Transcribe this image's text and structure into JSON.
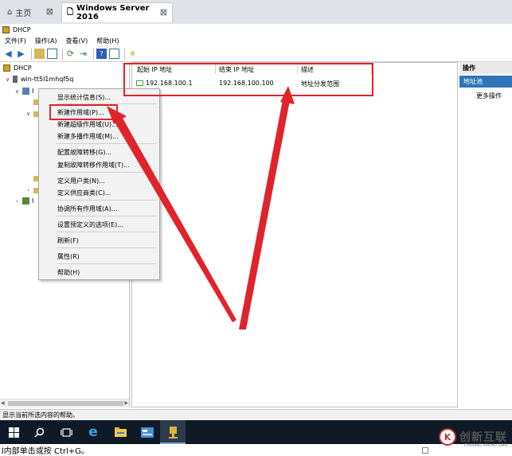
{
  "browser": {
    "tabs": [
      {
        "label": "主页",
        "icon": "home-icon"
      },
      {
        "label": "Windows Server 2016",
        "icon": "document-icon"
      }
    ],
    "close_glyph": "⊠"
  },
  "window": {
    "title": "DHCP"
  },
  "menubar": [
    "文件(F)",
    "操作(A)",
    "查看(V)",
    "帮助(H)"
  ],
  "toolbar": {
    "icons": [
      "back-arrow-icon",
      "forward-arrow-icon",
      "up-folder-icon",
      "console-tree-icon",
      "refresh-icon",
      "export-icon",
      "help-icon",
      "properties-icon",
      "star-icon"
    ]
  },
  "tree": {
    "root": "DHCP",
    "server": "win-tt5l1mhqf5q",
    "ipv4_partial": "I",
    "ipv6_partial": "I"
  },
  "table": {
    "columns": [
      "起始 IP 地址",
      "结束 IP 地址",
      "描述"
    ],
    "rows": [
      {
        "start": "192.168.100.1",
        "end": "192.168.100.100",
        "desc": "地址分发范围"
      }
    ]
  },
  "actions": {
    "title": "操作",
    "section": "地址池",
    "more": "更多操作"
  },
  "context_menu": {
    "items": [
      "显示统计信息(S)...",
      "新建作用域(P)...",
      "新建超级作用域(U)...",
      "新建多播作用域(M)...",
      "配置故障转移(G)...",
      "复制故障转移作用域(T)...",
      "定义用户类(N)...",
      "定义供应商类(C)...",
      "协调所有作用域(A)...",
      "设置预定义的选项(E)...",
      "刷新(F)",
      "属性(R)",
      "帮助(H)"
    ]
  },
  "statusbar": {
    "text": "显示当前所选内容的帮助。"
  },
  "taskbar": {
    "icons": [
      "windows-start-icon",
      "search-icon",
      "task-view-icon",
      "internet-explorer-icon",
      "file-explorer-icon",
      "server-manager-icon",
      "dhcp-console-icon"
    ]
  },
  "bottom_strip": {
    "text": "l内部单击或按 Ctrl+G。"
  },
  "watermark": {
    "text": "创新互联",
    "sub": "CHUANG XIN HU LIAN",
    "badge": "K"
  },
  "colors": {
    "annotation_red": "#e0242b",
    "selection_blue": "#2f76b8",
    "taskbar": "#101a26"
  }
}
